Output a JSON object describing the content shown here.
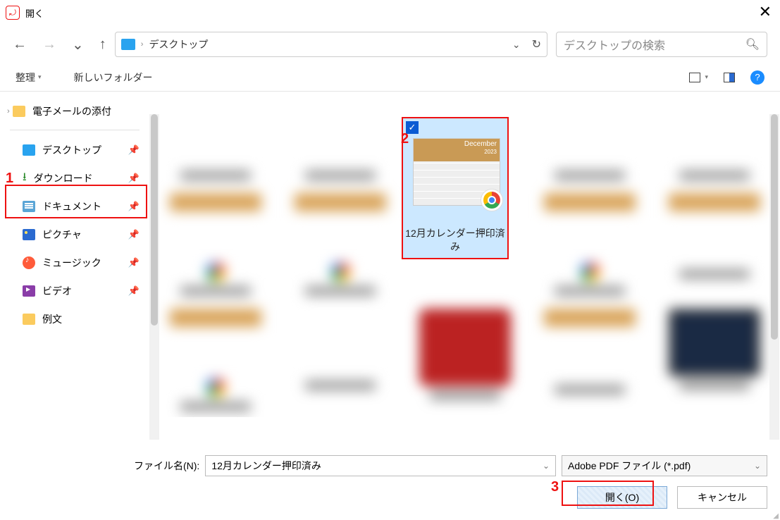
{
  "window": {
    "title": "開く"
  },
  "breadcrumb": {
    "location": "デスクトップ"
  },
  "search": {
    "placeholder": "デスクトップの検索"
  },
  "toolbar": {
    "organize": "整理",
    "new_folder": "新しいフォルダー"
  },
  "sidebar": {
    "top_item": "電子メールの添付",
    "items": [
      {
        "label": "デスクトップ",
        "icon": "desktop"
      },
      {
        "label": "ダウンロード",
        "icon": "download"
      },
      {
        "label": "ドキュメント",
        "icon": "document"
      },
      {
        "label": "ピクチャ",
        "icon": "picture"
      },
      {
        "label": "ミュージック",
        "icon": "music"
      },
      {
        "label": "ビデオ",
        "icon": "video"
      },
      {
        "label": "例文",
        "icon": "folder"
      }
    ]
  },
  "selected_file": {
    "name": "12月カレンダー押印済み",
    "thumb_header": "December",
    "thumb_year": "2023"
  },
  "bottom": {
    "filename_label": "ファイル名(N):",
    "filename_value": "12月カレンダー押印済み",
    "filetype_value": "Adobe PDF ファイル (*.pdf)",
    "open_label": "開く(O)",
    "cancel_label": "キャンセル"
  },
  "annotations": {
    "n1": "1",
    "n2": "2",
    "n3": "3"
  }
}
